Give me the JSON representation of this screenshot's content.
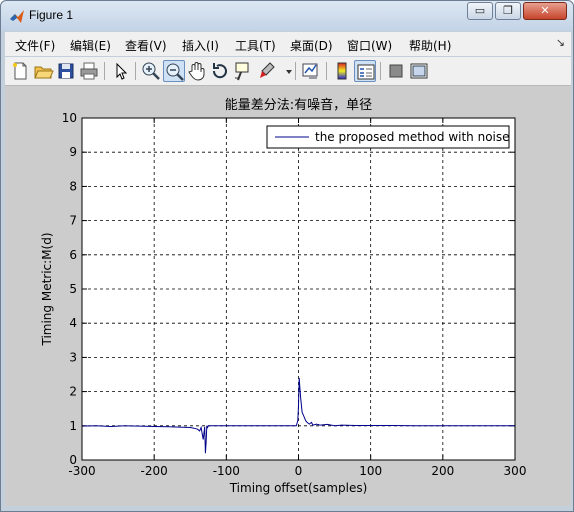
{
  "window": {
    "title": "Figure 1",
    "controls": {
      "minimize": "▭",
      "maximize": "❐",
      "close": "✕"
    }
  },
  "menu": {
    "items": [
      "文件(F)",
      "编辑(E)",
      "查看(V)",
      "插入(I)",
      "工具(T)",
      "桌面(D)",
      "窗口(W)",
      "帮助(H)"
    ],
    "overflow_glyph": "↘"
  },
  "toolbar": {
    "buttons": [
      {
        "icon": "new-figure-icon"
      },
      {
        "icon": "open-file-icon"
      },
      {
        "icon": "save-icon"
      },
      {
        "icon": "print-icon"
      },
      {
        "icon": "pointer-icon"
      },
      {
        "icon": "zoom-in-icon"
      },
      {
        "icon": "zoom-out-icon"
      },
      {
        "icon": "pan-icon"
      },
      {
        "icon": "rotate-3d-icon"
      },
      {
        "icon": "data-cursor-icon"
      },
      {
        "icon": "brush-icon"
      },
      {
        "icon": "link-plot-icon"
      },
      {
        "icon": "colorbar-icon"
      },
      {
        "icon": "legend-icon"
      },
      {
        "icon": "hide-plot-tools-icon"
      },
      {
        "icon": "show-plot-tools-icon"
      }
    ]
  },
  "colors": {
    "figure_bg": "#cccccc",
    "axes_bg": "#ffffff",
    "series": "#00008b",
    "accent": "#3a6ea5"
  },
  "chart_data": {
    "type": "line",
    "title": "能量差分法:有噪音，单径",
    "xlabel": "Timing offset(samples)",
    "ylabel": "Timing Metric:M(d)",
    "xlim": [
      -300,
      300
    ],
    "ylim": [
      0,
      10
    ],
    "xticks": [
      -300,
      -200,
      -100,
      0,
      100,
      200,
      300
    ],
    "yticks": [
      0,
      1,
      2,
      3,
      4,
      5,
      6,
      7,
      8,
      9,
      10
    ],
    "xtick_labels": [
      "-300",
      "-200",
      "-100",
      "0",
      "100",
      "200",
      "300"
    ],
    "ytick_labels": [
      "0",
      "1",
      "2",
      "3",
      "4",
      "5",
      "6",
      "7",
      "8",
      "9",
      "10"
    ],
    "grid": true,
    "grid_style": "dashed",
    "legend_position": "top-right",
    "series": [
      {
        "name": "the proposed method with noise",
        "color": "#00008b",
        "x": [
          -300,
          -280,
          -260,
          -240,
          -220,
          -200,
          -180,
          -160,
          -150,
          -145,
          -140,
          -137,
          -135,
          -132,
          -130,
          -129,
          -128,
          -127,
          -126,
          -125,
          -123,
          -120,
          -100,
          -50,
          -10,
          -3,
          -1,
          0,
          1,
          2,
          3,
          4,
          5,
          6,
          8,
          10,
          12,
          15,
          18,
          20,
          25,
          30,
          40,
          50,
          60,
          80,
          100,
          130,
          160,
          200,
          250,
          300
        ],
        "y": [
          0.99,
          1.0,
          0.98,
          1.0,
          0.99,
          0.98,
          0.97,
          0.96,
          0.95,
          0.93,
          0.9,
          0.85,
          0.95,
          0.6,
          0.97,
          0.2,
          0.5,
          1.0,
          0.95,
          1.0,
          1.0,
          1.0,
          1.0,
          1.0,
          1.0,
          1.0,
          1.15,
          1.6,
          2.4,
          2.1,
          1.8,
          1.6,
          1.4,
          1.35,
          1.25,
          1.15,
          1.1,
          1.05,
          1.1,
          1.02,
          1.05,
          1.02,
          1.04,
          1.0,
          1.02,
          1.01,
          1.01,
          1.01,
          1.0,
          1.0,
          1.0,
          1.0
        ]
      }
    ]
  }
}
